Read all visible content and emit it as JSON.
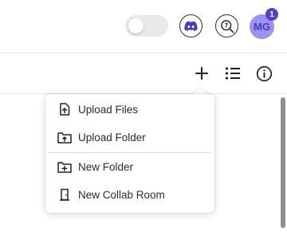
{
  "topbar": {
    "avatar_initials": "MG",
    "notification_count": "1",
    "accent_color": "#5b3fc4",
    "avatar_bg": "#9b93f0"
  },
  "toolbar": {
    "icons": [
      "plus-icon",
      "list-icon",
      "info-icon"
    ]
  },
  "menu": {
    "items": [
      {
        "label": "Upload Files",
        "icon": "upload-file-icon"
      },
      {
        "label": "Upload Folder",
        "icon": "upload-folder-icon"
      },
      {
        "label": "New Folder",
        "icon": "new-folder-icon"
      },
      {
        "label": "New Collab Room",
        "icon": "collab-room-icon"
      }
    ]
  }
}
